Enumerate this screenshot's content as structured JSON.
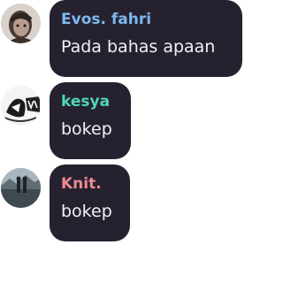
{
  "messages": [
    {
      "author": "Evos. fahri",
      "author_color": "#7eb8f0",
      "text": "Pada bahas apaan",
      "avatar_icon": "profile-photo-icon"
    },
    {
      "author": "kesya",
      "author_color": "#4fd8b8",
      "text": "bokep",
      "avatar_icon": "profile-photo-icon"
    },
    {
      "author": "Knit.",
      "author_color": "#f08a92",
      "text": "bokep",
      "avatar_icon": "profile-photo-icon"
    }
  ],
  "colors": {
    "bubble_background": "#26212f",
    "message_text": "#f2f1f5"
  }
}
